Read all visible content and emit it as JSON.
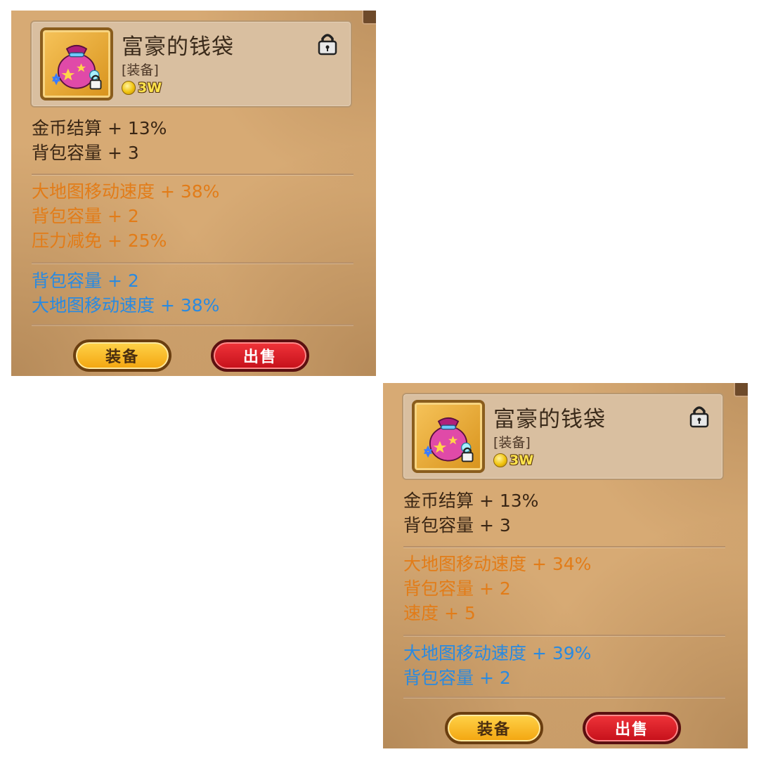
{
  "cards": [
    {
      "item_name": "富豪的钱袋",
      "item_type": "[装备]",
      "price": "3W",
      "base_stats": [
        "金币结算 + 13%",
        "背包容量 + 3"
      ],
      "orange_stats": [
        "大地图移动速度 + 38%",
        "背包容量 + 2",
        "压力减免 + 25%"
      ],
      "blue_stats": [
        "背包容量 + 2",
        "大地图移动速度 + 38%"
      ],
      "equip_label": "装备",
      "sell_label": "出售"
    },
    {
      "item_name": "富豪的钱袋",
      "item_type": "[装备]",
      "price": "3W",
      "base_stats": [
        "金币结算 + 13%",
        "背包容量 + 3"
      ],
      "orange_stats": [
        "大地图移动速度 + 34%",
        "背包容量 + 2",
        "速度 + 5"
      ],
      "blue_stats": [
        "大地图移动速度 + 39%",
        "背包容量 + 2"
      ],
      "equip_label": "装备",
      "sell_label": "出售"
    }
  ],
  "colors": {
    "panel_bg": "#d7aa74",
    "stat_base": "#3a2614",
    "stat_orange": "#e27c18",
    "stat_blue": "#2a8ae0",
    "price_text": "#ffe44d"
  },
  "icons": {
    "item": "money-bag-icon",
    "lock": "lock-icon",
    "coin": "coin-icon"
  }
}
